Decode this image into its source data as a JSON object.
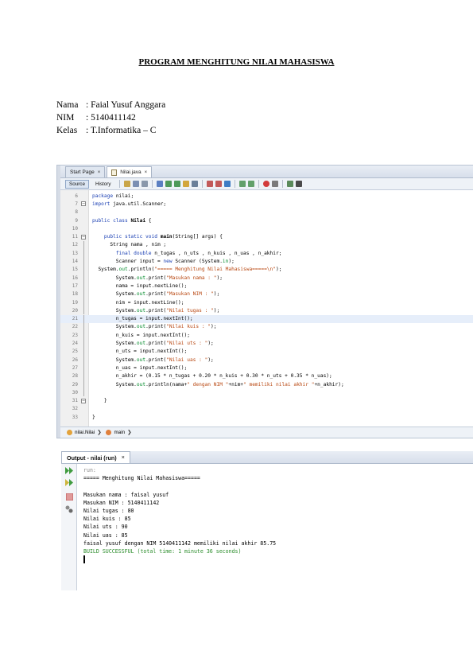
{
  "document": {
    "title": "PROGRAM MENGHITUNG NILAI MAHASISWA",
    "identity": [
      {
        "label": "Nama",
        "value": ": Faial Yusuf Anggara"
      },
      {
        "label": "NIM",
        "value": ": 5140411142"
      },
      {
        "label": "Kelas",
        "value": ": T.Informatika – C"
      }
    ]
  },
  "editor": {
    "tabs": [
      {
        "label": "Start Page",
        "close": "×"
      },
      {
        "label": "Nilai.java",
        "close": "×"
      }
    ],
    "toolbar": {
      "source_label": "Source",
      "history_label": "History"
    },
    "code_lines": [
      {
        "n": "6",
        "fold": "",
        "parts": [
          {
            "t": "package ",
            "c": "kw"
          },
          {
            "t": "nilai;",
            "c": ""
          }
        ]
      },
      {
        "n": "7",
        "fold": "minus",
        "parts": [
          {
            "t": "import ",
            "c": "kw"
          },
          {
            "t": "java.util.Scanner;",
            "c": ""
          }
        ]
      },
      {
        "n": "8",
        "fold": "",
        "parts": []
      },
      {
        "n": "9",
        "fold": "",
        "parts": [
          {
            "t": "public class ",
            "c": "kw"
          },
          {
            "t": "Nilai",
            "c": "bold"
          },
          {
            "t": " {",
            "c": ""
          }
        ]
      },
      {
        "n": "10",
        "fold": "",
        "parts": []
      },
      {
        "n": "11",
        "fold": "minus",
        "parts": [
          {
            "t": "    public static void ",
            "c": "kw"
          },
          {
            "t": "main",
            "c": "bold"
          },
          {
            "t": "(String[] args) {",
            "c": ""
          }
        ]
      },
      {
        "n": "12",
        "fold": "line",
        "parts": [
          {
            "t": "      String nama , nim ;",
            "c": ""
          }
        ]
      },
      {
        "n": "13",
        "fold": "line",
        "parts": [
          {
            "t": "        ",
            "c": ""
          },
          {
            "t": "final double ",
            "c": "kw"
          },
          {
            "t": "n_tugas , n_uts , n_kuis , n_uas , n_akhir;",
            "c": ""
          }
        ]
      },
      {
        "n": "14",
        "fold": "line",
        "parts": [
          {
            "t": "        Scanner input = ",
            "c": ""
          },
          {
            "t": "new ",
            "c": "kw"
          },
          {
            "t": "Scanner (System.",
            "c": ""
          },
          {
            "t": "in",
            "c": "fld"
          },
          {
            "t": ");",
            "c": ""
          }
        ]
      },
      {
        "n": "15",
        "fold": "line",
        "parts": [
          {
            "t": "  System.",
            "c": ""
          },
          {
            "t": "out",
            "c": "fld"
          },
          {
            "t": ".println(",
            "c": ""
          },
          {
            "t": "\"===== Menghitung Nilai Mahasiswa=====\\n\"",
            "c": "str"
          },
          {
            "t": ");",
            "c": ""
          }
        ]
      },
      {
        "n": "16",
        "fold": "line",
        "parts": [
          {
            "t": "        System.",
            "c": ""
          },
          {
            "t": "out",
            "c": "fld"
          },
          {
            "t": ".print(",
            "c": ""
          },
          {
            "t": "\"Masukan nama : \"",
            "c": "str"
          },
          {
            "t": ");",
            "c": ""
          }
        ]
      },
      {
        "n": "17",
        "fold": "line",
        "parts": [
          {
            "t": "        nama = input.nextLine();",
            "c": ""
          }
        ]
      },
      {
        "n": "18",
        "fold": "line",
        "parts": [
          {
            "t": "        System.",
            "c": ""
          },
          {
            "t": "out",
            "c": "fld"
          },
          {
            "t": ".print(",
            "c": ""
          },
          {
            "t": "\"Masukan NIM : \"",
            "c": "str"
          },
          {
            "t": ");",
            "c": ""
          }
        ]
      },
      {
        "n": "19",
        "fold": "line",
        "parts": [
          {
            "t": "        nim = input.nextLine();",
            "c": ""
          }
        ]
      },
      {
        "n": "20",
        "fold": "line",
        "parts": [
          {
            "t": "        System.",
            "c": ""
          },
          {
            "t": "out",
            "c": "fld"
          },
          {
            "t": ".print(",
            "c": ""
          },
          {
            "t": "\"Nilai tugas : \"",
            "c": "str"
          },
          {
            "t": ");",
            "c": ""
          }
        ]
      },
      {
        "n": "21",
        "fold": "line",
        "hl": true,
        "parts": [
          {
            "t": "        n_tugas = input.nextInt();",
            "c": ""
          }
        ]
      },
      {
        "n": "22",
        "fold": "line",
        "parts": [
          {
            "t": "        System.",
            "c": ""
          },
          {
            "t": "out",
            "c": "fld"
          },
          {
            "t": ".print(",
            "c": ""
          },
          {
            "t": "\"Nilai kuis : \"",
            "c": "str"
          },
          {
            "t": ");",
            "c": ""
          }
        ]
      },
      {
        "n": "23",
        "fold": "line",
        "parts": [
          {
            "t": "        n_kuis = input.nextInt();",
            "c": ""
          }
        ]
      },
      {
        "n": "24",
        "fold": "line",
        "parts": [
          {
            "t": "        System.",
            "c": ""
          },
          {
            "t": "out",
            "c": "fld"
          },
          {
            "t": ".print(",
            "c": ""
          },
          {
            "t": "\"Nilai uts : \"",
            "c": "str"
          },
          {
            "t": ");",
            "c": ""
          }
        ]
      },
      {
        "n": "25",
        "fold": "line",
        "parts": [
          {
            "t": "        n_uts = input.nextInt();",
            "c": ""
          }
        ]
      },
      {
        "n": "26",
        "fold": "line",
        "parts": [
          {
            "t": "        System.",
            "c": ""
          },
          {
            "t": "out",
            "c": "fld"
          },
          {
            "t": ".print(",
            "c": ""
          },
          {
            "t": "\"Nilai uas : \"",
            "c": "str"
          },
          {
            "t": ");",
            "c": ""
          }
        ]
      },
      {
        "n": "27",
        "fold": "line",
        "parts": [
          {
            "t": "        n_uas = input.nextInt();",
            "c": ""
          }
        ]
      },
      {
        "n": "28",
        "fold": "line",
        "parts": [
          {
            "t": "        n_akhir = (0.15 * n_tugas + 0.20 * n_kuis + 0.30 * n_uts + 0.35 * n_uas);",
            "c": ""
          }
        ]
      },
      {
        "n": "29",
        "fold": "line",
        "parts": [
          {
            "t": "        System.",
            "c": ""
          },
          {
            "t": "out",
            "c": "fld"
          },
          {
            "t": ".println(nama+",
            "c": ""
          },
          {
            "t": "\" dengan NIM \"",
            "c": "str"
          },
          {
            "t": "+nim+",
            "c": ""
          },
          {
            "t": "\" memiliki nilai akhir \"",
            "c": "str"
          },
          {
            "t": "+n_akhir);",
            "c": ""
          }
        ]
      },
      {
        "n": "30",
        "fold": "line",
        "parts": []
      },
      {
        "n": "31",
        "fold": "minus",
        "parts": [
          {
            "t": "    }",
            "c": ""
          }
        ]
      },
      {
        "n": "32",
        "fold": "",
        "parts": []
      },
      {
        "n": "33",
        "fold": "",
        "parts": [
          {
            "t": "}",
            "c": ""
          }
        ]
      }
    ],
    "breadcrumb": {
      "class_label": "nilai.Nilai",
      "method_label": "main"
    }
  },
  "output": {
    "tab_label": "Output - nilai (run)",
    "tab_close": "×",
    "lines": [
      {
        "t": "run:",
        "c": "gray"
      },
      {
        "t": "===== Menghitung Nilai Mahasiswa=====",
        "c": ""
      },
      {
        "t": "",
        "c": ""
      },
      {
        "t": "Masukan nama : faisal yusuf",
        "c": ""
      },
      {
        "t": "Masukan NIM : 5140411142",
        "c": ""
      },
      {
        "t": "Nilai tugas : 80",
        "c": ""
      },
      {
        "t": "Nilai kuis : 85",
        "c": ""
      },
      {
        "t": "Nilai uts : 90",
        "c": ""
      },
      {
        "t": "Nilai uas : 85",
        "c": ""
      },
      {
        "t": "faisal yusuf dengan NIM 5140411142 memiliki nilai akhir 85.75",
        "c": ""
      },
      {
        "t": "BUILD SUCCESSFUL (total time: 1 minute 36 seconds)",
        "c": "green"
      }
    ]
  },
  "colors": {
    "keyword": "#1a3fb3",
    "string": "#b8460f",
    "field": "#008a2a",
    "success": "#2a8c2a"
  }
}
